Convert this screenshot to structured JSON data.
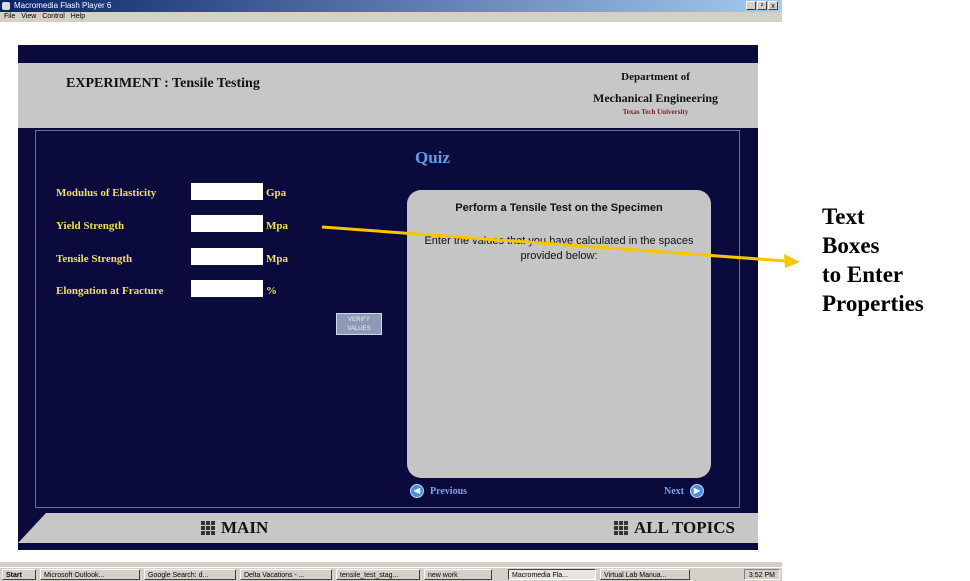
{
  "window": {
    "title": "Macromedia Flash Player 6",
    "controls": [
      "_",
      "²",
      "x"
    ],
    "menu": [
      "File",
      "View",
      "Control",
      "Help"
    ]
  },
  "header": {
    "title": "EXPERIMENT : Tensile Testing",
    "dept_line1": "Department of",
    "dept_line2": "Mechanical Engineering",
    "dept_line3": "Texas Tech University"
  },
  "quiz": {
    "title": "Quiz",
    "fields": [
      {
        "label": "Modulus of Elasticity",
        "unit": "Gpa",
        "value": ""
      },
      {
        "label": "Yield Strength",
        "unit": "Mpa",
        "value": ""
      },
      {
        "label": "Tensile Strength",
        "unit": "Mpa",
        "value": ""
      },
      {
        "label": "Elongation at Fracture",
        "unit": "%",
        "value": ""
      }
    ],
    "verify_label": "VERIFY VALUES"
  },
  "panel": {
    "heading": "Perform a Tensile Test on the Specimen",
    "body": "Enter the values that you have calculated in the spaces provided below:"
  },
  "nav": {
    "previous": "Previous",
    "next": "Next",
    "main": "MAIN",
    "all_topics": "ALL TOPICS"
  },
  "taskbar": {
    "start": "Start",
    "tasks": [
      "Microsoft Outlook...",
      "Google Search: d...",
      "Delta Vacations - ...",
      "tensile_test_stag...",
      "new work",
      "Macromedia Fla...",
      "Virtual Lab Manua..."
    ],
    "clock": "3:52 PM"
  },
  "annotation": {
    "lines": [
      "Text",
      "Boxes",
      "to Enter",
      "Properties"
    ],
    "arrow_color": "#f7c600"
  }
}
